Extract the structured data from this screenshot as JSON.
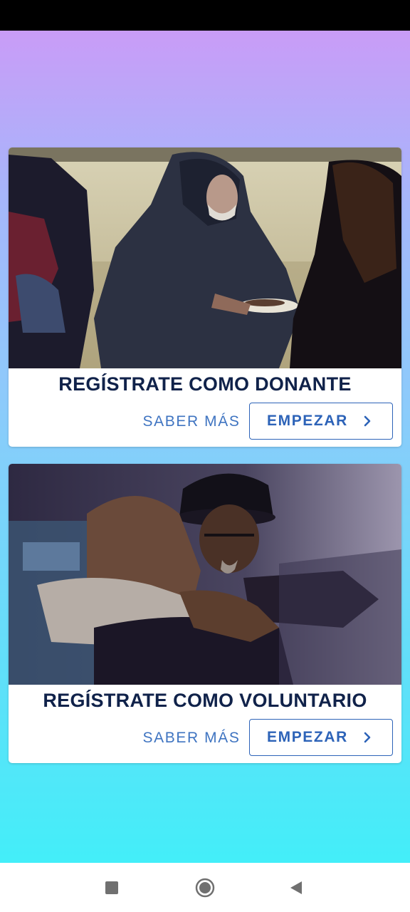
{
  "cards": [
    {
      "title": "REGÍSTRATE COMO DONANTE",
      "more_label": "SABER MÁS",
      "start_label": "EMPEZAR",
      "image_icon": "people-sharing-food-photo"
    },
    {
      "title": "REGÍSTRATE COMO VOLUNTARIO",
      "more_label": "SABER MÁS",
      "start_label": "EMPEZAR",
      "image_icon": "people-hugging-photo"
    }
  ],
  "icons": {
    "chevron": "chevron-right-icon",
    "recent": "square-icon",
    "home": "circle-icon",
    "back": "triangle-left-icon"
  },
  "colors": {
    "title": "#10224a",
    "accent": "#2d63b8",
    "gradient_top": "#c99cf7",
    "gradient_bottom": "#43eef9"
  }
}
